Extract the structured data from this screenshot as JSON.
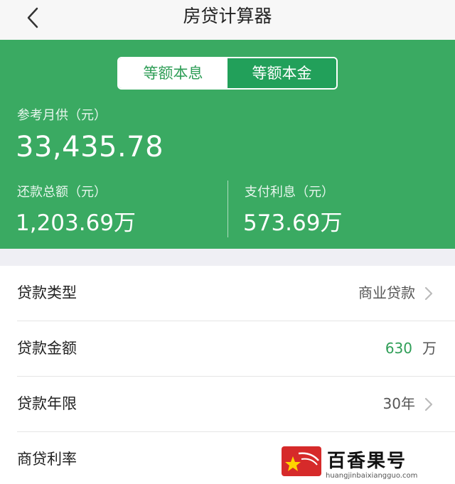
{
  "nav": {
    "title": "房贷计算器",
    "back_icon": "chevron-left-icon"
  },
  "mode_toggle": {
    "options": [
      "等额本息",
      "等额本金"
    ],
    "selected": "等额本息"
  },
  "summary": {
    "monthly_label": "参考月供（元）",
    "monthly_value": "33,435.78",
    "total_label": "还款总额（元）",
    "total_value": "1,203.69万",
    "interest_label": "支付利息（元）",
    "interest_value": "573.69万"
  },
  "form": {
    "loan_type": {
      "label": "贷款类型",
      "value": "商业贷款"
    },
    "loan_amount": {
      "label": "贷款金额",
      "value": "630",
      "unit": "万"
    },
    "loan_term": {
      "label": "贷款年限",
      "value": "30年"
    },
    "rate": {
      "label": "商贷利率"
    }
  },
  "watermark": {
    "text": "百香果号",
    "url": "huangjinbaixiangguo.com"
  },
  "colors": {
    "accent": "#3aaa62",
    "accent_text": "#2f9e57"
  }
}
